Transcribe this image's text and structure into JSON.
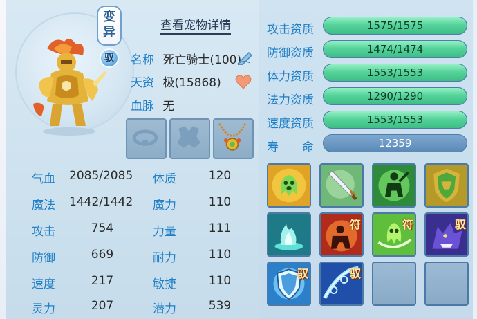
{
  "portrait": {
    "transform_tag": "变异",
    "ride_tag": "驭"
  },
  "header": {
    "view_details": "查看宠物详情"
  },
  "info": {
    "name_label": "名称",
    "name_value": "死亡骑士(100)",
    "talent_label": "天资",
    "talent_value": "极(15868)",
    "blood_label": "血脉",
    "blood_value": "无"
  },
  "equipment": [
    "collar-slot",
    "armor-slot",
    "necklace"
  ],
  "stats": {
    "hp_label": "气血",
    "hp_value": "2085/2085",
    "mp_label": "魔法",
    "mp_value": "1442/1442",
    "atk_label": "攻击",
    "atk_value": "754",
    "def_label": "防御",
    "def_value": "669",
    "spd_label": "速度",
    "spd_value": "217",
    "spr_label": "灵力",
    "spr_value": "207",
    "con_label": "体质",
    "con_value": "120",
    "mag_label": "魔力",
    "mag_value": "110",
    "str_label": "力量",
    "str_value": "111",
    "end_label": "耐力",
    "end_value": "110",
    "agi_label": "敏捷",
    "agi_value": "110",
    "pot_label": "潜力",
    "pot_value": "539"
  },
  "aptitudes": [
    {
      "label": "攻击资质",
      "value": "1575/1575",
      "fill": 1.0
    },
    {
      "label": "防御资质",
      "value": "1474/1474",
      "fill": 1.0
    },
    {
      "label": "体力资质",
      "value": "1553/1553",
      "fill": 1.0
    },
    {
      "label": "法力资质",
      "value": "1290/1290",
      "fill": 1.0
    },
    {
      "label": "速度资质",
      "value": "1553/1553",
      "fill": 1.0
    }
  ],
  "lifespan": {
    "label_a": "寿",
    "label_b": "命",
    "value": "12359"
  },
  "skills": [
    {
      "icon": "green-ghost-icon",
      "badge": ""
    },
    {
      "icon": "sword-icon",
      "badge": ""
    },
    {
      "icon": "warrior-silhouette-icon",
      "badge": ""
    },
    {
      "icon": "green-shield-icon",
      "badge": ""
    },
    {
      "icon": "blue-flame-icon",
      "badge": ""
    },
    {
      "icon": "red-warrior-icon",
      "badge": "符"
    },
    {
      "icon": "green-spirit-icon",
      "badge": "符"
    },
    {
      "icon": "purple-wolf-icon",
      "badge": "驭"
    },
    {
      "icon": "blue-shield-icon",
      "badge": "驭"
    },
    {
      "icon": "blue-chain-icon",
      "badge": "驭"
    },
    {
      "icon": "",
      "badge": ""
    },
    {
      "icon": "",
      "badge": ""
    }
  ],
  "colors": {
    "label_blue": "#1f7fc7",
    "bar_green": "#56d39b",
    "bar_plain": "#5b8ab8"
  }
}
